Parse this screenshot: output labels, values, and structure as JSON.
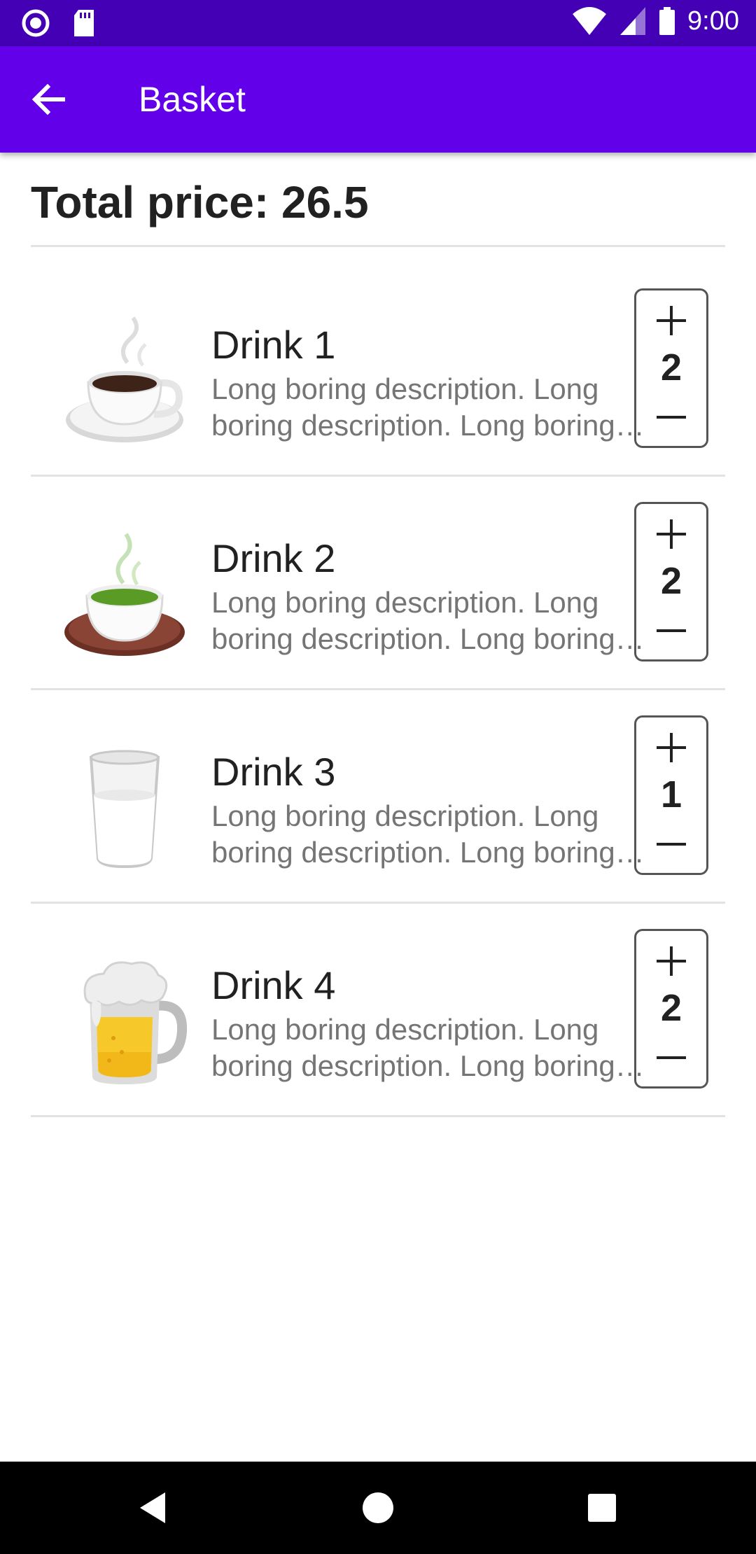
{
  "status_bar": {
    "time": "9:00",
    "icons": [
      "record-icon",
      "sd-card-icon",
      "wifi-icon",
      "signal-icon",
      "battery-icon"
    ]
  },
  "app_bar": {
    "title": "Basket",
    "back_icon": "arrow-back-icon",
    "background": "#6200ea"
  },
  "basket": {
    "total_label": "Total price: 26.5",
    "items": [
      {
        "name": "Drink 1",
        "description": "Long boring description. Long boring description. Long boring description.",
        "quantity": "2",
        "icon": "hot-coffee-icon"
      },
      {
        "name": "Drink 2",
        "description": "Long boring description. Long boring description. Long boring description.",
        "quantity": "2",
        "icon": "green-tea-icon"
      },
      {
        "name": "Drink 3",
        "description": "Long boring description. Long boring description. Long boring description.",
        "quantity": "1",
        "icon": "glass-of-milk-icon"
      },
      {
        "name": "Drink 4",
        "description": "Long boring description. Long boring description. Long boring description.",
        "quantity": "2",
        "icon": "beer-mug-icon"
      }
    ]
  },
  "nav_bar": {
    "buttons": [
      "back-triangle-icon",
      "home-circle-icon",
      "recents-square-icon"
    ]
  }
}
